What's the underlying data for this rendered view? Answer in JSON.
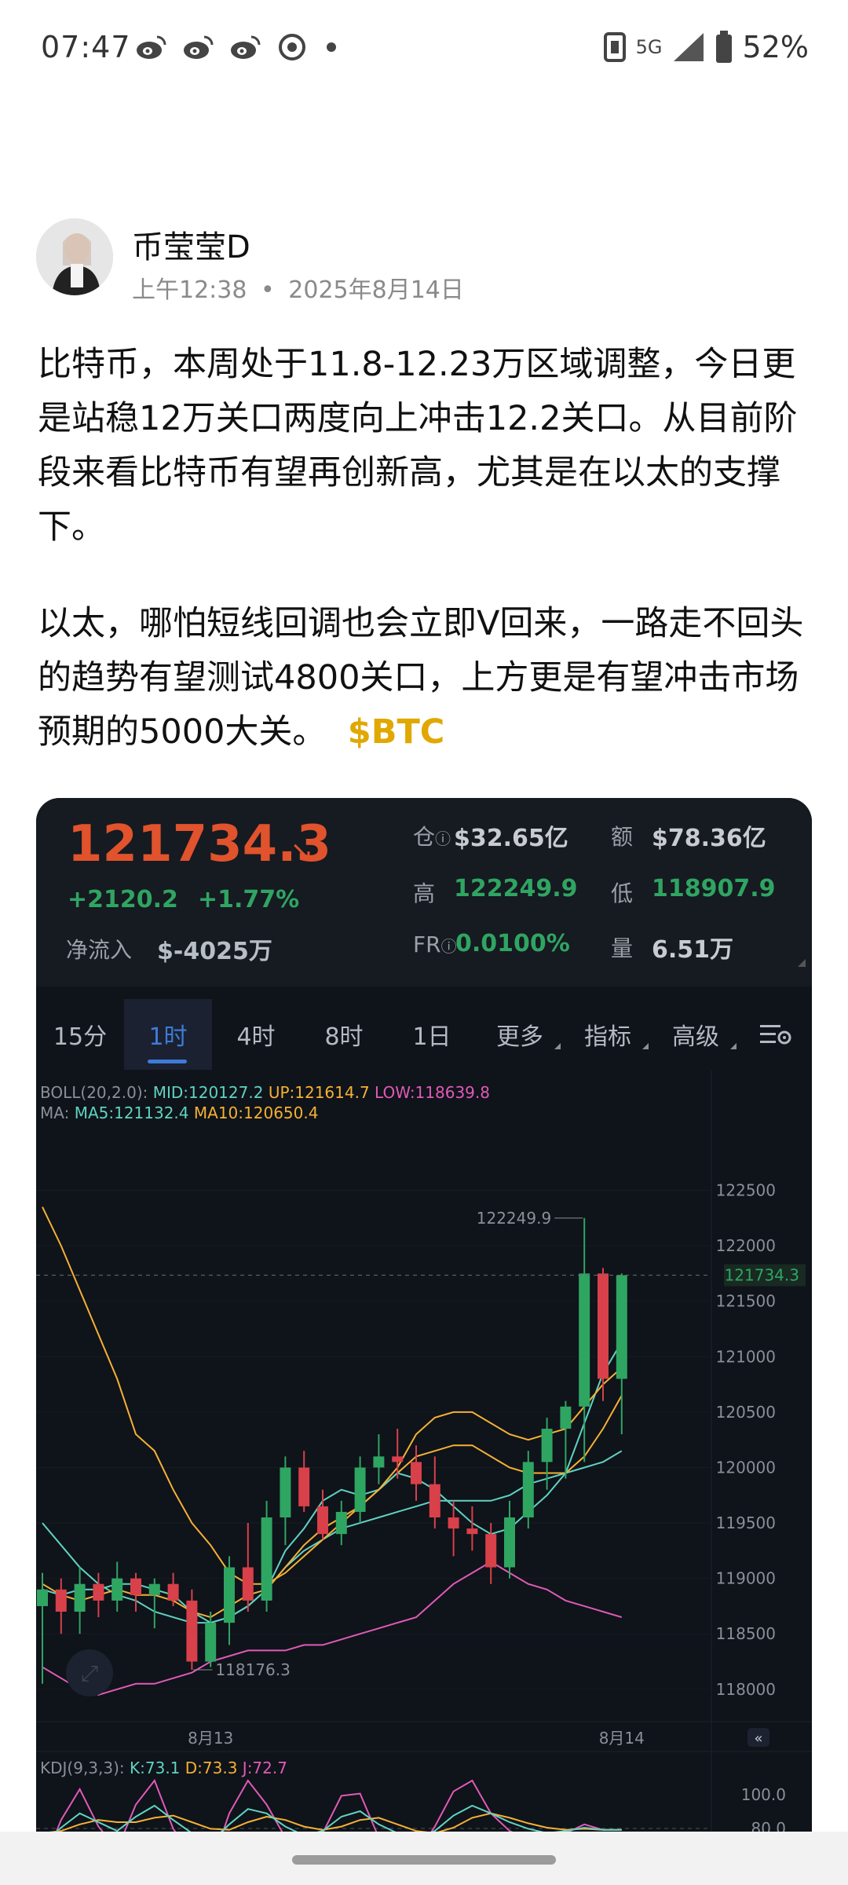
{
  "status_bar": {
    "time": "07:47",
    "left_icons": [
      "weibo-icon",
      "weibo-icon",
      "weibo-icon",
      "camera-icon",
      "dot-icon"
    ],
    "network": "5G",
    "battery": "52%"
  },
  "post": {
    "author": "币莹莹D",
    "time": "上午12:38",
    "date": "2025年8月14日",
    "paragraph1": "比特币，本周处于11.8-12.23万区域调整，今日更是站稳12万关口两度向上冲击12.2关口。从目前阶段来看比特币有望再创新高，尤其是在以太的支撑下。",
    "paragraph2": "以太，哪怕短线回调也会立即V回来，一路走不回头的趋势有望测试4800关口，上方更是有望冲击市场预期的5000大关。",
    "tag": "$BTC"
  },
  "ticker": {
    "price": "121734.3",
    "change": "+2120.2",
    "change_pct": "+1.77%",
    "net_flow_label": "净流入",
    "net_flow": "$-4025万",
    "oi_label": "仓",
    "oi_value": "$32.65亿",
    "amount_label": "额",
    "amount_value": "$78.36亿",
    "high_label": "高",
    "high_value": "122249.9",
    "low_label": "低",
    "low_value": "118907.9",
    "fr_label": "FR",
    "fr_value": "0.0100%",
    "volume_label": "量",
    "volume_value": "6.51万"
  },
  "tabs": [
    "15分",
    "1时",
    "4时",
    "8时",
    "1日",
    "更多",
    "指标",
    "高级"
  ],
  "active_tab": "1时",
  "colors": {
    "up": "#2fa562",
    "down": "#d8404a",
    "price_orange": "#e0532c",
    "active_blue": "#3d7bd8",
    "tag_gold": "#e0a800",
    "card_bg": "#0f131a"
  },
  "chart_data": {
    "type": "candlestick",
    "indicators": {
      "boll_label": "BOLL(20,2.0):",
      "mid": "MID:120127.2",
      "up": "UP:121614.7",
      "low": "LOW:118639.8",
      "ma_label": "MA:",
      "ma5": "MA5:121132.4",
      "ma10": "MA10:120650.4"
    },
    "y_ticks": [
      "122500",
      "122000",
      "121500",
      "121000",
      "120500",
      "120000",
      "119500",
      "119000",
      "118500",
      "118000"
    ],
    "ylim": [
      117850,
      122950
    ],
    "x_labels": [
      "8月13",
      "8月14"
    ],
    "x_label_index": [
      9,
      31
    ],
    "current_price_label": "121734.3",
    "current_price": 121734.3,
    "high_marker": "122249.9",
    "high_index": 29,
    "low_marker": "118176.3",
    "low_index": 8,
    "candles": [
      {
        "o": 118750,
        "h": 119050,
        "l": 118050,
        "c": 118900
      },
      {
        "o": 118900,
        "h": 119000,
        "l": 118500,
        "c": 118700
      },
      {
        "o": 118700,
        "h": 119100,
        "l": 118500,
        "c": 118950
      },
      {
        "o": 118950,
        "h": 119050,
        "l": 118650,
        "c": 118800
      },
      {
        "o": 118800,
        "h": 119150,
        "l": 118700,
        "c": 119000
      },
      {
        "o": 119000,
        "h": 119050,
        "l": 118700,
        "c": 118850
      },
      {
        "o": 118850,
        "h": 119000,
        "l": 118550,
        "c": 118950
      },
      {
        "o": 118950,
        "h": 119050,
        "l": 118750,
        "c": 118800
      },
      {
        "o": 118800,
        "h": 118900,
        "l": 118176,
        "c": 118250
      },
      {
        "o": 118250,
        "h": 118700,
        "l": 118200,
        "c": 118600
      },
      {
        "o": 118600,
        "h": 119200,
        "l": 118400,
        "c": 119100
      },
      {
        "o": 119100,
        "h": 119500,
        "l": 118700,
        "c": 118800
      },
      {
        "o": 118800,
        "h": 119700,
        "l": 118700,
        "c": 119550
      },
      {
        "o": 119550,
        "h": 120100,
        "l": 119300,
        "c": 120000
      },
      {
        "o": 120000,
        "h": 120150,
        "l": 119600,
        "c": 119650
      },
      {
        "o": 119650,
        "h": 119800,
        "l": 119350,
        "c": 119400
      },
      {
        "o": 119400,
        "h": 119700,
        "l": 119300,
        "c": 119600
      },
      {
        "o": 119600,
        "h": 120100,
        "l": 119500,
        "c": 120000
      },
      {
        "o": 120000,
        "h": 120300,
        "l": 119850,
        "c": 120100
      },
      {
        "o": 120100,
        "h": 120350,
        "l": 119900,
        "c": 120050
      },
      {
        "o": 120050,
        "h": 120200,
        "l": 119700,
        "c": 119850
      },
      {
        "o": 119850,
        "h": 120100,
        "l": 119450,
        "c": 119550
      },
      {
        "o": 119550,
        "h": 119700,
        "l": 119200,
        "c": 119450
      },
      {
        "o": 119450,
        "h": 119650,
        "l": 119250,
        "c": 119400
      },
      {
        "o": 119400,
        "h": 119500,
        "l": 118950,
        "c": 119100
      },
      {
        "o": 119100,
        "h": 119700,
        "l": 119000,
        "c": 119550
      },
      {
        "o": 119550,
        "h": 120150,
        "l": 119450,
        "c": 120050
      },
      {
        "o": 120050,
        "h": 120450,
        "l": 119800,
        "c": 120350
      },
      {
        "o": 120350,
        "h": 120600,
        "l": 119900,
        "c": 120550
      },
      {
        "o": 120550,
        "h": 122249.9,
        "l": 120050,
        "c": 121750
      },
      {
        "o": 121750,
        "h": 121800,
        "l": 120600,
        "c": 120800
      },
      {
        "o": 120800,
        "h": 121750,
        "l": 120300,
        "c": 121734.3
      }
    ],
    "boll_up": [
      118200,
      118100,
      118000,
      117950,
      118000,
      118050,
      118050,
      118100,
      118150,
      118250,
      118300,
      118350,
      118350,
      118350,
      118400,
      118400,
      118450,
      118500,
      118550,
      118600,
      118650,
      118800,
      118950,
      119050,
      119150,
      119050,
      118950,
      118900,
      118800,
      118750,
      118700,
      118650
    ],
    "boll_mid": [
      119500,
      119300,
      119100,
      118950,
      118850,
      118800,
      118700,
      118650,
      118600,
      118600,
      118650,
      118750,
      118900,
      119100,
      119250,
      119350,
      119450,
      119500,
      119550,
      119600,
      119650,
      119700,
      119700,
      119700,
      119700,
      119750,
      119850,
      119900,
      119950,
      120000,
      120050,
      120150
    ],
    "ma5": [
      118900,
      118850,
      118900,
      118900,
      118950,
      118950,
      118900,
      118850,
      118700,
      118600,
      118650,
      118750,
      118900,
      119250,
      119450,
      119700,
      119800,
      119750,
      119800,
      119950,
      119900,
      119800,
      119650,
      119500,
      119400,
      119450,
      119600,
      119750,
      119950,
      120400,
      120850,
      121132
    ],
    "ma10": [
      122350,
      122000,
      121600,
      121200,
      120800,
      120300,
      120150,
      119800,
      119500,
      119300,
      119050,
      118950,
      118950,
      119050,
      119200,
      119350,
      119500,
      119650,
      119800,
      119950,
      120100,
      120150,
      120200,
      120200,
      120100,
      120000,
      119950,
      119950,
      119950,
      120100,
      120350,
      120650
    ],
    "boll_lower_visible": [
      118950,
      118850,
      118800,
      118850,
      118900,
      118850,
      118850,
      118800,
      118700,
      118650,
      118750,
      118850,
      118900,
      119100,
      119300,
      119450,
      119550,
      119650,
      119800,
      120000,
      120300,
      120450,
      120500,
      120500,
      120400,
      120300,
      120250,
      120300,
      120350,
      120550,
      120750,
      120900
    ],
    "kdj": {
      "label": "KDJ(9,3,3):",
      "k": "K:73.1",
      "d": "D:73.3",
      "j": "J:72.7",
      "y_ticks": [
        "100.0",
        "80.0"
      ]
    }
  }
}
